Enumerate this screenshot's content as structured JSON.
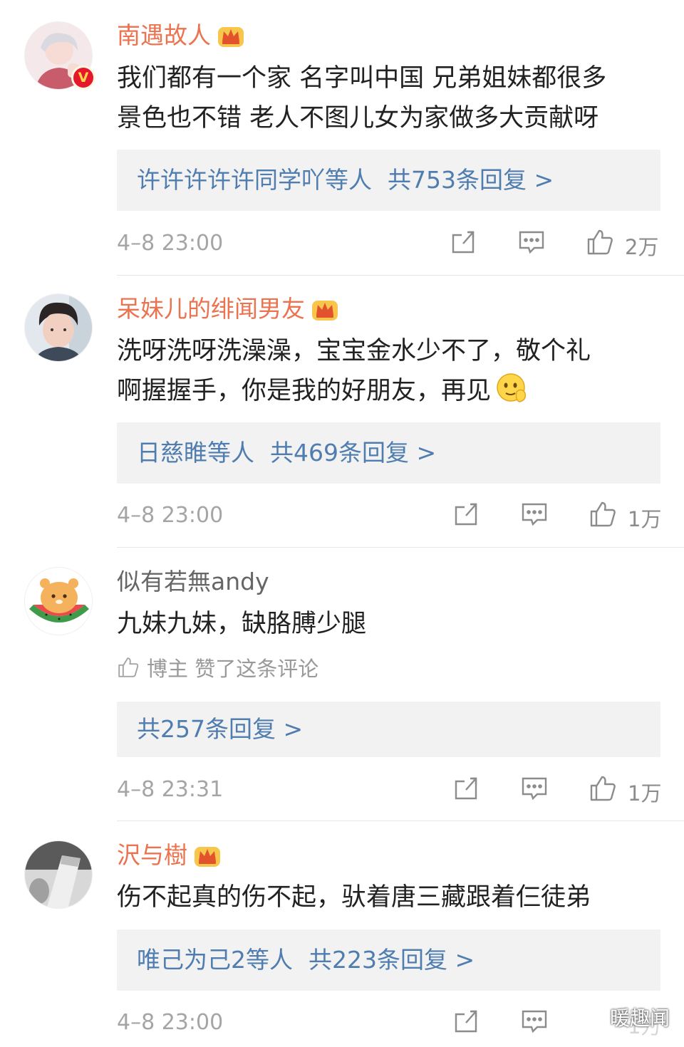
{
  "comments": [
    {
      "username": "南遇故人",
      "text_lines": [
        "我们都有一个家 名字叫中国 兄弟姐妹都很多",
        "景色也不错 老人不图儿女为家做多大贡献呀"
      ],
      "reply_names": "许许许许许同学吖等人",
      "reply_count": "共753条回复 >",
      "timestamp": "4–8 23:00",
      "likes": "2万",
      "verified": true
    },
    {
      "username": "呆妹儿的绯闻男友",
      "text_lines": [
        "洗呀洗呀洗澡澡，宝宝金水少不了，敬个礼",
        "啊握握手，你是我的好朋友，再见"
      ],
      "emoji": "shy-smile-emoji",
      "reply_names": "日慈睢等人",
      "reply_count": "共469条回复 >",
      "timestamp": "4–8 23:00",
      "likes": "1万"
    },
    {
      "username": "似有若無andy",
      "text_lines": [
        "九妹九妹，缺胳膊少腿"
      ],
      "liked_note": "博主 赞了这条评论",
      "reply_count": "共257条回复 >",
      "timestamp": "4–8 23:31",
      "likes": "1万"
    },
    {
      "username": "沢与樹",
      "text_lines": [
        "伤不起真的伤不起，驮着唐三藏跟着仨徒弟"
      ],
      "reply_names": "唯己为己2等人",
      "reply_count": "共223条回复 >",
      "timestamp": "4–8 23:00",
      "likes": "1万"
    }
  ],
  "watermark": "暖趣闻",
  "colors": {
    "vip_name": "#eb7350",
    "link": "#507daf",
    "reply_bg": "#f2f2f2",
    "meta_text": "#a5a5a5",
    "verified_badge": "#e6162d"
  }
}
